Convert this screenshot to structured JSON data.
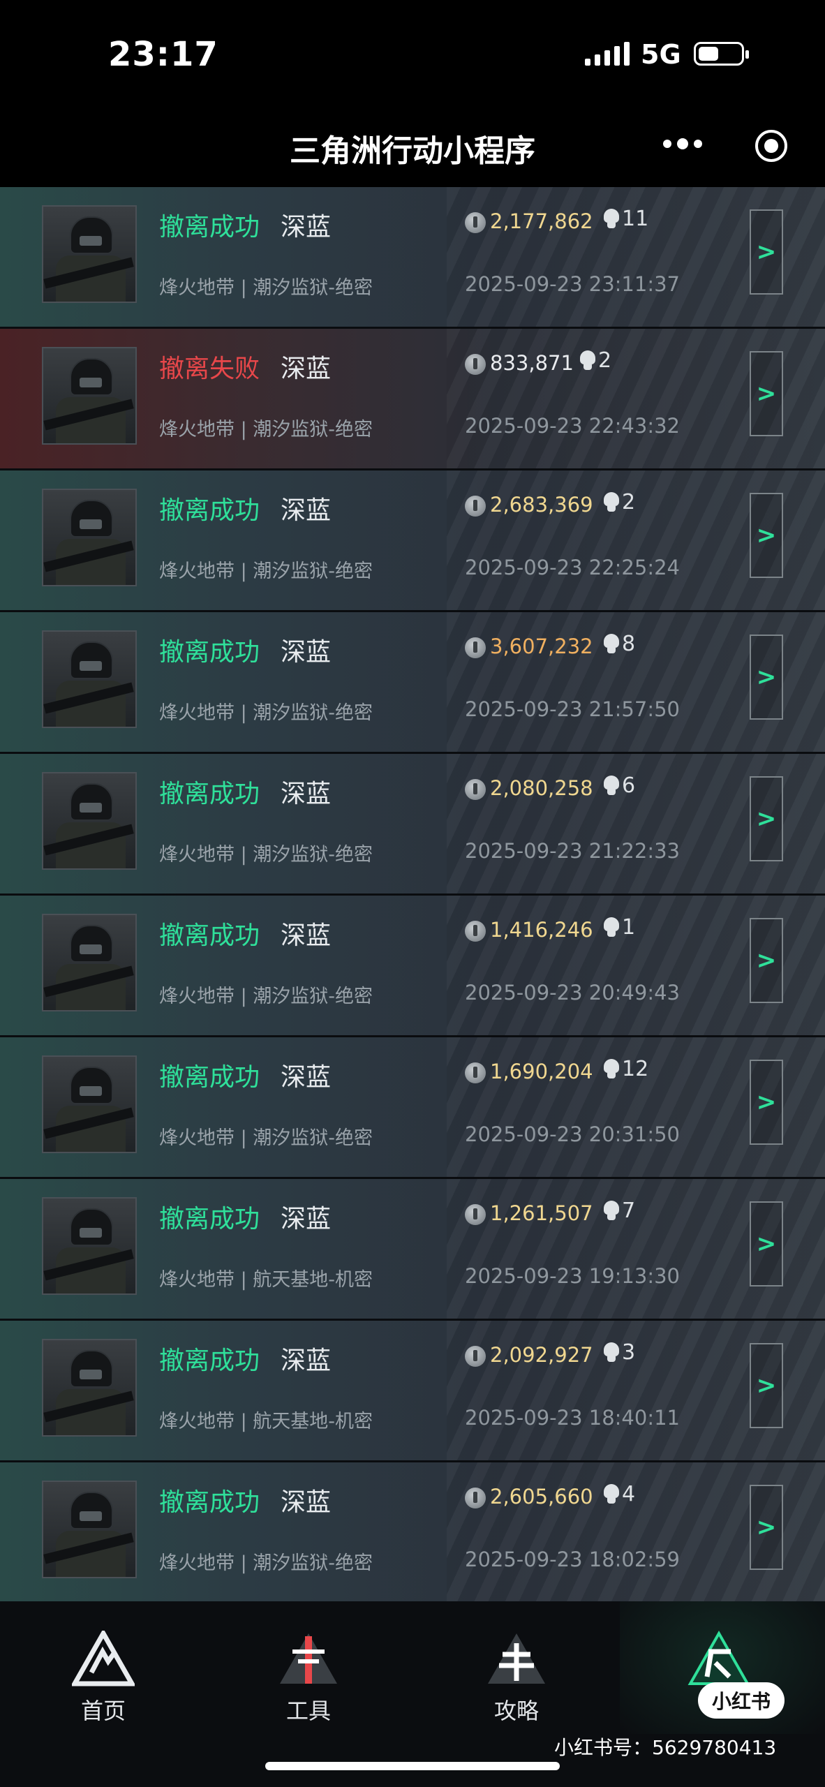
{
  "status_bar": {
    "time": "23:17",
    "network": "5G"
  },
  "nav": {
    "title": "三角洲行动小程序"
  },
  "records": [
    {
      "status": "撤离成功",
      "result": "success",
      "player": "深蓝",
      "mode": "烽火地带 | 潮汐监狱-绝密",
      "value": "2,177,862",
      "value_tone": "gold",
      "kills": "11",
      "datetime": "2025-09-23 23:11:37",
      "action": ">"
    },
    {
      "status": "撤离失败",
      "result": "fail",
      "player": "深蓝",
      "mode": "烽火地带 | 潮汐监狱-绝密",
      "value": "833,871",
      "value_tone": "white",
      "kills": "2",
      "datetime": "2025-09-23 22:43:32",
      "action": ">"
    },
    {
      "status": "撤离成功",
      "result": "success",
      "player": "深蓝",
      "mode": "烽火地带 | 潮汐监狱-绝密",
      "value": "2,683,369",
      "value_tone": "gold",
      "kills": "2",
      "datetime": "2025-09-23 22:25:24",
      "action": ">"
    },
    {
      "status": "撤离成功",
      "result": "success",
      "player": "深蓝",
      "mode": "烽火地带 | 潮汐监狱-绝密",
      "value": "3,607,232",
      "value_tone": "orange",
      "kills": "8",
      "datetime": "2025-09-23 21:57:50",
      "action": ">"
    },
    {
      "status": "撤离成功",
      "result": "success",
      "player": "深蓝",
      "mode": "烽火地带 | 潮汐监狱-绝密",
      "value": "2,080,258",
      "value_tone": "gold",
      "kills": "6",
      "datetime": "2025-09-23 21:22:33",
      "action": ">"
    },
    {
      "status": "撤离成功",
      "result": "success",
      "player": "深蓝",
      "mode": "烽火地带 | 潮汐监狱-绝密",
      "value": "1,416,246",
      "value_tone": "gold",
      "kills": "1",
      "datetime": "2025-09-23 20:49:43",
      "action": ">"
    },
    {
      "status": "撤离成功",
      "result": "success",
      "player": "深蓝",
      "mode": "烽火地带 | 潮汐监狱-绝密",
      "value": "1,690,204",
      "value_tone": "gold",
      "kills": "12",
      "datetime": "2025-09-23 20:31:50",
      "action": ">"
    },
    {
      "status": "撤离成功",
      "result": "success",
      "player": "深蓝",
      "mode": "烽火地带 | 航天基地-机密",
      "value": "1,261,507",
      "value_tone": "gold",
      "kills": "7",
      "datetime": "2025-09-23 19:13:30",
      "action": ">"
    },
    {
      "status": "撤离成功",
      "result": "success",
      "player": "深蓝",
      "mode": "烽火地带 | 航天基地-机密",
      "value": "2,092,927",
      "value_tone": "gold",
      "kills": "3",
      "datetime": "2025-09-23 18:40:11",
      "action": ">"
    },
    {
      "status": "撤离成功",
      "result": "success",
      "player": "深蓝",
      "mode": "烽火地带 | 潮汐监狱-绝密",
      "value": "2,605,660",
      "value_tone": "gold",
      "kills": "4",
      "datetime": "2025-09-23 18:02:59",
      "action": ">"
    }
  ],
  "tabs": [
    {
      "label": "首页",
      "icon": "home-icon"
    },
    {
      "label": "工具",
      "icon": "tools-icon"
    },
    {
      "label": "攻略",
      "icon": "guide-icon"
    },
    {
      "label": "",
      "icon": "celebration-icon"
    }
  ],
  "badge": {
    "text": "小红书"
  },
  "watermark": {
    "text": "小红书号：5629780413"
  },
  "colors": {
    "success": "#2fe09a",
    "fail": "#e8474a",
    "value_gold": "#f0d790",
    "value_orange": "#f0b060"
  }
}
